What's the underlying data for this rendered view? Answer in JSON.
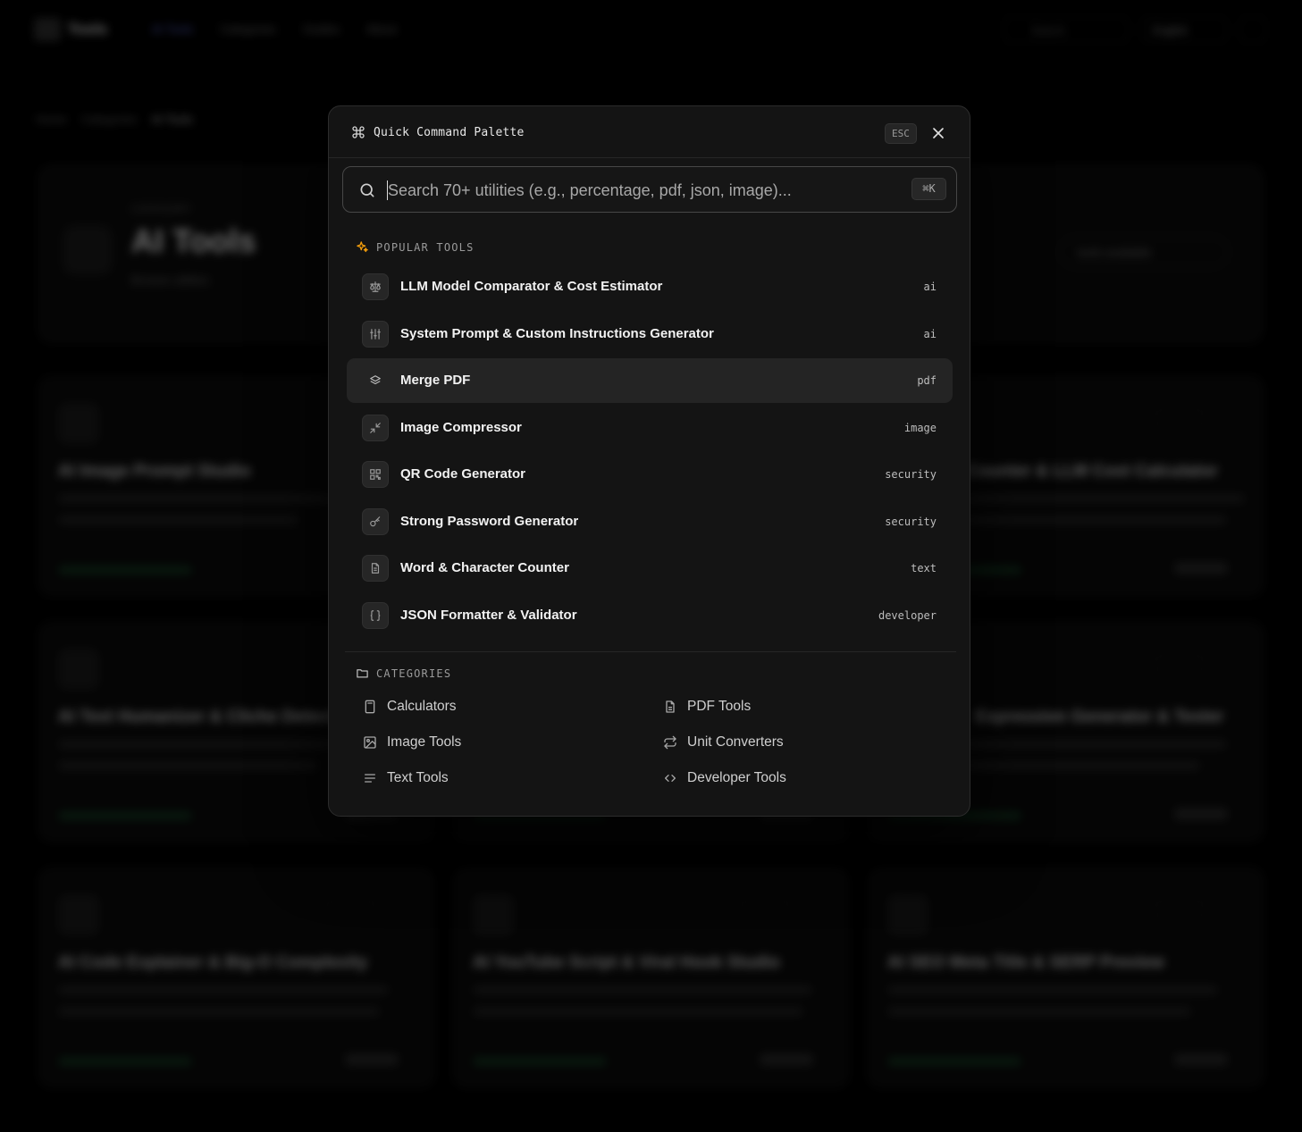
{
  "background": {
    "brand": "Tools",
    "nav": [
      "AI Tools",
      "Categories",
      "Guides",
      "About"
    ],
    "search_label": "Search",
    "language": "English",
    "breadcrumb": [
      "Home",
      "Categories",
      "AI Tools"
    ],
    "hero": {
      "kicker": "CATEGORY",
      "title": "AI Tools",
      "subtitle": "Browse utilities",
      "pill": "tools available"
    },
    "cards": [
      {
        "title": "AI Image Prompt Studio"
      },
      {
        "title": ""
      },
      {
        "title": "Counter & LLM Cost Calculator"
      },
      {
        "title": "AI Text Humanizer & Cliche Detector"
      },
      {
        "title": ""
      },
      {
        "title": "Expression Generator & Tester"
      },
      {
        "title": "AI Code Explainer & Big-O Complexity"
      },
      {
        "title": "AI YouTube Script & Viral Hook Studio"
      },
      {
        "title": "AI SEO Meta Title & SERP Preview"
      }
    ]
  },
  "palette": {
    "title": "Quick Command Palette",
    "esc_label": "ESC",
    "search": {
      "placeholder": "Search 70+ utilities (e.g., percentage, pdf, json, image)...",
      "value": "",
      "shortcut": "⌘K"
    },
    "popular_heading": "POPULAR TOOLS",
    "tools": [
      {
        "name": "LLM Model Comparator & Cost Estimator",
        "category": "ai",
        "icon": "scale-icon",
        "selected": false
      },
      {
        "name": "System Prompt & Custom Instructions Generator",
        "category": "ai",
        "icon": "sliders-icon",
        "selected": false
      },
      {
        "name": "Merge PDF",
        "category": "pdf",
        "icon": "layers-icon",
        "selected": true
      },
      {
        "name": "Image Compressor",
        "category": "image",
        "icon": "minimize-icon",
        "selected": false
      },
      {
        "name": "QR Code Generator",
        "category": "security",
        "icon": "qr-code-icon",
        "selected": false
      },
      {
        "name": "Strong Password Generator",
        "category": "security",
        "icon": "key-icon",
        "selected": false
      },
      {
        "name": "Word & Character Counter",
        "category": "text",
        "icon": "file-text-icon",
        "selected": false
      },
      {
        "name": "JSON Formatter & Validator",
        "category": "developer",
        "icon": "braces-icon",
        "selected": false
      }
    ],
    "categories_heading": "CATEGORIES",
    "categories": [
      {
        "label": "Calculators",
        "icon": "calculator-icon"
      },
      {
        "label": "PDF Tools",
        "icon": "file-icon"
      },
      {
        "label": "Image Tools",
        "icon": "image-icon"
      },
      {
        "label": "Unit Converters",
        "icon": "arrows-swap-icon"
      },
      {
        "label": "Text Tools",
        "icon": "text-lines-icon"
      },
      {
        "label": "Developer Tools",
        "icon": "code-icon"
      }
    ]
  },
  "colors": {
    "page_bg": "#000000",
    "palette_bg": "#141414",
    "selected_row": "#242424",
    "sparkle_accent": "#f59e0b",
    "nav_active": "#6f7dff"
  }
}
